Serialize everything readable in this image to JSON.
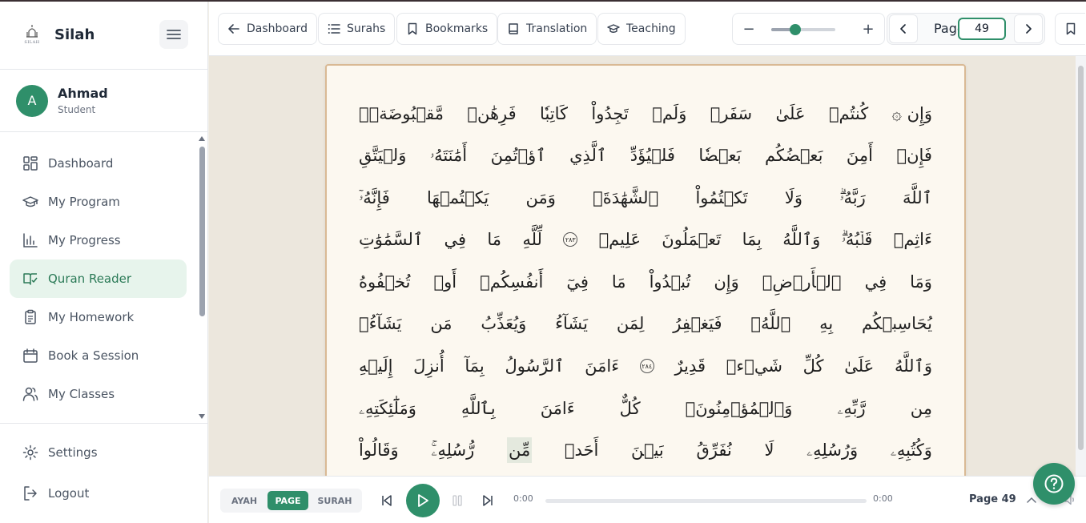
{
  "app": {
    "name": "Silah",
    "logo_text": "SILAH"
  },
  "user": {
    "initial": "A",
    "name": "Ahmad",
    "role": "Student"
  },
  "sidebar": {
    "items": [
      {
        "label": "Dashboard",
        "icon": "grid-icon"
      },
      {
        "label": "My Program",
        "icon": "graduation-cap-icon"
      },
      {
        "label": "My Progress",
        "icon": "bar-chart-icon"
      },
      {
        "label": "Quran Reader",
        "icon": "book-open-icon",
        "active": true
      },
      {
        "label": "My Homework",
        "icon": "clipboard-icon"
      },
      {
        "label": "Book a Session",
        "icon": "calendar-icon"
      },
      {
        "label": "My Classes",
        "icon": "users-icon"
      }
    ],
    "bottom": [
      {
        "label": "Settings",
        "icon": "gear-icon"
      },
      {
        "label": "Logout",
        "icon": "logout-icon"
      }
    ]
  },
  "toolbar": {
    "dashboard": "Dashboard",
    "surahs": "Surahs",
    "bookmarks": "Bookmarks",
    "translation": "Translation",
    "teaching": "Teaching",
    "zoom_minus": "−",
    "zoom_plus": "+",
    "zoom_level": 0.38,
    "page_label": "Page",
    "page_value": "49"
  },
  "mushaf": {
    "lines": [
      [
        "۞ وَإِن",
        "كُنتُمۡ",
        "عَلَىٰ",
        "سَفَرٖ",
        "وَلَمۡ",
        "تَجِدُواْ",
        "كَاتِبٗا",
        "فَرِهَٰنٞ",
        "مَّقۡبُوضَةٞۖ"
      ],
      [
        "فَإِنۡ",
        "أَمِنَ",
        "بَعۡضُكُم",
        "بَعۡضٗا",
        "فَلۡيُؤَدِّ",
        "ٱلَّذِي",
        "ٱؤۡتُمِنَ",
        "أَمَٰنَتَهُۥ",
        "وَلۡيَتَّقِ"
      ],
      [
        "ٱللَّهَ",
        "رَبَّهُۥۗ",
        "وَلَا",
        "تَكۡتُمُواْ",
        "ٱلشَّهَٰدَةَۚ",
        "وَمَن",
        "يَكۡتُمۡهَا",
        "فَإِنَّهُۥٓ"
      ],
      [
        "ءَاثِمٞ",
        "قَلۡبُهُۥۗ",
        "وَٱللَّهُ",
        "بِمَا",
        "تَعۡمَلُونَ",
        "عَلِيمٞ",
        "٢٨٣",
        "لِّلَّهِ",
        "مَا",
        "فِي",
        "ٱلسَّمَٰوَٰتِ"
      ],
      [
        "وَمَا",
        "فِي",
        "ٱلۡأَرۡضِۗ",
        "وَإِن",
        "تُبۡدُواْ",
        "مَا",
        "فِيٓ",
        "أَنفُسِكُمۡ",
        "أَوۡ",
        "تُخۡفُوهُ"
      ],
      [
        "يُحَاسِبۡكُم",
        "بِهِ",
        "ٱللَّهُۖ",
        "فَيَغۡفِرُ",
        "لِمَن",
        "يَشَآءُ",
        "وَيُعَذِّبُ",
        "مَن",
        "يَشَآءُۗ"
      ],
      [
        "وَٱللَّهُ",
        "عَلَىٰ",
        "كُلِّ",
        "شَيۡءٖ",
        "قَدِيرٌ",
        "٢٨٤",
        "ءَامَنَ",
        "ٱلرَّسُولُ",
        "بِمَآ",
        "أُنزِلَ",
        "إِلَيۡهِ"
      ],
      [
        "مِن",
        "رَّبِّهِۦ",
        "وَٱلۡمُؤۡمِنُونَۚ",
        "كُلٌّ",
        "ءَامَنَ",
        "بِٱللَّهِ",
        "وَمَلَٰٓئِكَتِهِۦ"
      ],
      [
        "وَكُتُبِهِۦ",
        "وَرُسُلِهِۦ",
        "لَا",
        "نُفَرِّقُ",
        "بَيۡنَ",
        "أَحَدٖ",
        "مِّن",
        "رُّسُلِهِۦۚ",
        "وَقَالُواْ"
      ]
    ]
  },
  "audio": {
    "modes": [
      "AYAH",
      "PAGE",
      "SURAH"
    ],
    "active_mode": "PAGE",
    "current_time": "0:00",
    "total_time": "0:00",
    "page_tag": "Page 49",
    "progress": 0
  },
  "colors": {
    "accent": "#2f8f6a",
    "active_bg": "#e7f4ec",
    "page_border": "#d9b994",
    "page_bg": "#fcf8f0"
  }
}
